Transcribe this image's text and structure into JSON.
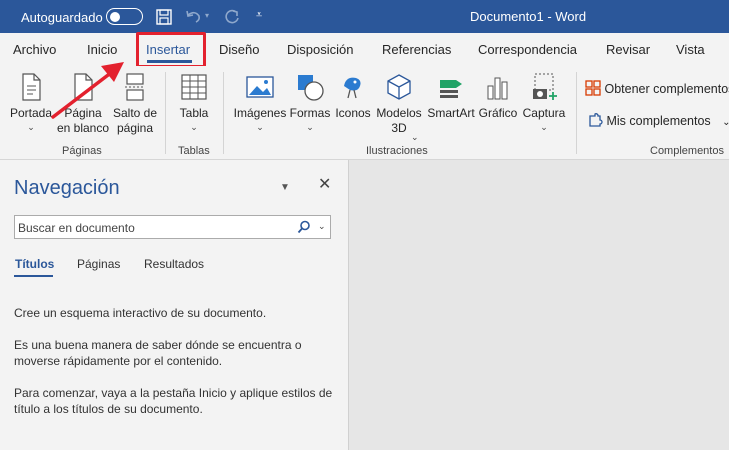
{
  "titlebar": {
    "autosave_label": "Autoguardado",
    "document_title": "Documento1 - Word",
    "background": "#2b579a"
  },
  "tabs": [
    {
      "label": "Archivo"
    },
    {
      "label": "Inicio"
    },
    {
      "label": "Insertar",
      "active": true
    },
    {
      "label": "Diseño"
    },
    {
      "label": "Disposición"
    },
    {
      "label": "Referencias"
    },
    {
      "label": "Correspondencia"
    },
    {
      "label": "Revisar"
    },
    {
      "label": "Vista"
    }
  ],
  "annotation": {
    "highlight_color": "#e3212e"
  },
  "ribbon": {
    "paginas": {
      "label": "Páginas",
      "portada": "Portada",
      "pagina_blanco_1": "Página",
      "pagina_blanco_2": "en blanco",
      "salto_1": "Salto de",
      "salto_2": "página"
    },
    "tablas": {
      "label": "Tablas",
      "tabla": "Tabla"
    },
    "ilustraciones": {
      "label": "Ilustraciones",
      "imagenes": "Imágenes",
      "formas": "Formas",
      "iconos": "Iconos",
      "modelos_1": "Modelos",
      "modelos_2": "3D",
      "smartart": "SmartArt",
      "grafico": "Gráfico",
      "captura": "Captura"
    },
    "complementos": {
      "label": "Complementos",
      "obtener": "Obtener complementos",
      "mis": "Mis complementos"
    }
  },
  "navpane": {
    "title": "Navegación",
    "search_placeholder": "Buscar en documento",
    "tabs": [
      "Títulos",
      "Páginas",
      "Resultados"
    ],
    "para1": "Cree un esquema interactivo de su documento.",
    "para2": "Es una buena manera de saber dónde se encuentra o moverse rápidamente por el contenido.",
    "para3": "Para comenzar, vaya a la pestaña Inicio y aplique estilos de título a los títulos de su documento."
  }
}
